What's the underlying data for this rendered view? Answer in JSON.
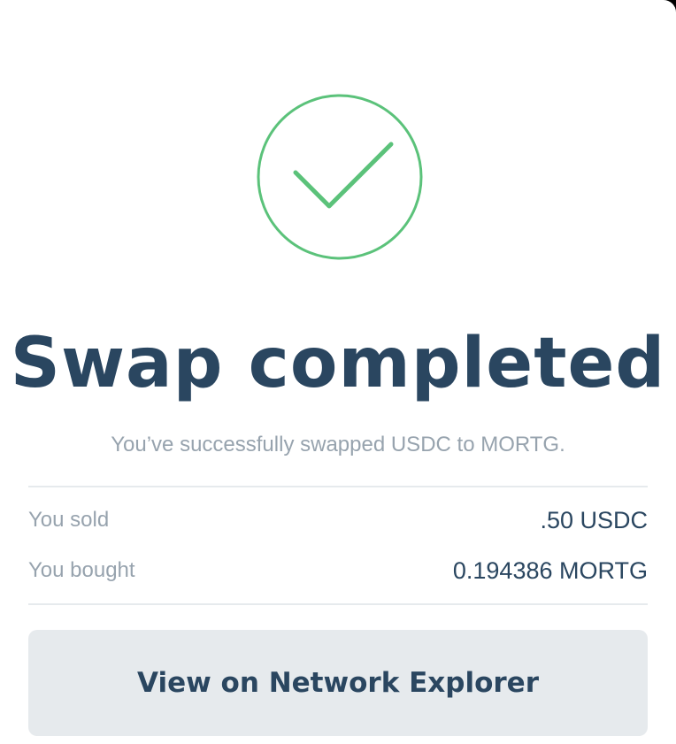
{
  "modal": {
    "status_icon": "checkmark-circle-icon",
    "title": "Swap completed",
    "subtitle": "You’ve successfully swapped USDC to MORTG.",
    "details": {
      "sold_label": "You sold",
      "sold_value": ".50 USDC",
      "bought_label": "You bought",
      "bought_value": "0.194386 MORTG"
    },
    "explorer_button_label": "View on Network Explorer"
  },
  "colors": {
    "success": "#5bc27a",
    "text_primary": "#2a4660",
    "text_secondary": "#97a3ae",
    "button_bg": "#e6eaed",
    "divider": "#e6eaed",
    "backdrop": "#000000"
  }
}
